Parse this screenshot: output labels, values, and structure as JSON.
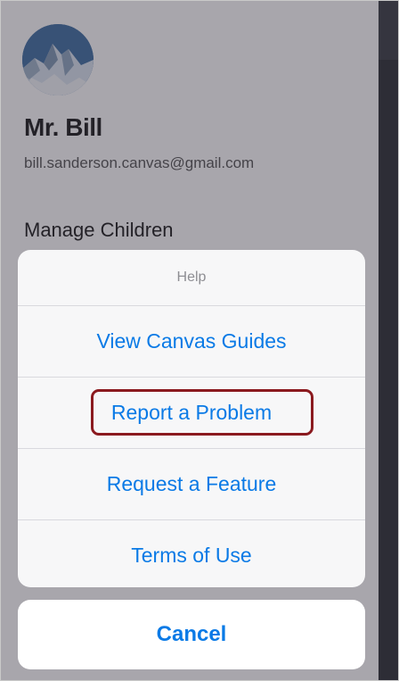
{
  "profile": {
    "name": "Mr. Bill",
    "email": "bill.sanderson.canvas@gmail.com",
    "avatar_icon": "mountain-avatar"
  },
  "menu": {
    "manage_children": "Manage Children"
  },
  "action_sheet": {
    "title": "Help",
    "items": [
      {
        "label": "View Canvas Guides"
      },
      {
        "label": "Report a Problem",
        "highlighted": true
      },
      {
        "label": "Request a Feature"
      },
      {
        "label": "Terms of Use"
      }
    ],
    "cancel_label": "Cancel"
  },
  "colors": {
    "action_blue": "#0a7ae6",
    "highlight_border": "#8b1a1f",
    "overlay": "#302c3a"
  }
}
